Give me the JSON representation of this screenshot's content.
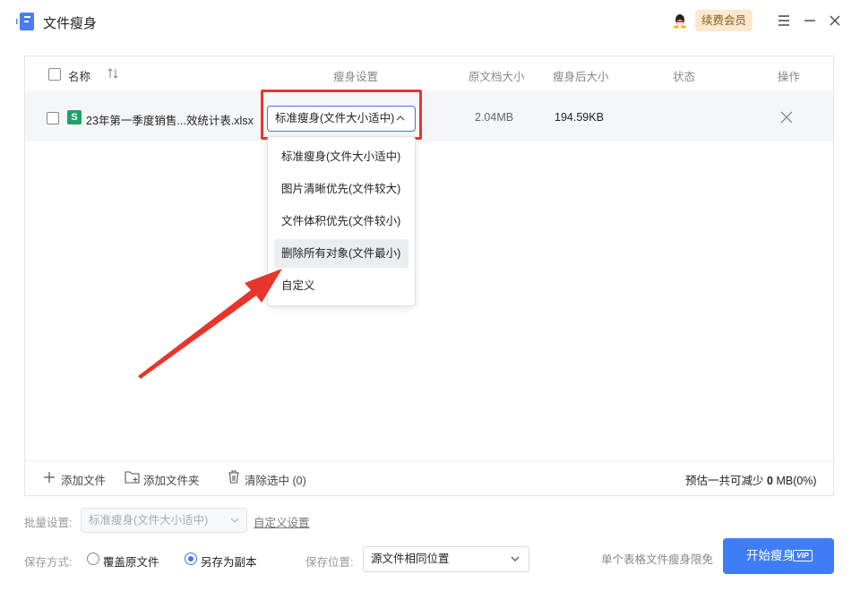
{
  "app": {
    "title": "文件瘦身",
    "vip_label": "续费会员"
  },
  "table": {
    "headers": {
      "name": "名称",
      "slim_setting": "瘦身设置",
      "orig_size": "原文档大小",
      "new_size": "瘦身后大小",
      "status": "状态",
      "action": "操作"
    },
    "rows": [
      {
        "file_name": "23年第一季度销售...效统计表.xlsx",
        "file_badge": "S",
        "slim_setting": "标准瘦身(文件大小适中)",
        "orig_size": "2.04MB",
        "new_size": "194.59KB",
        "status": ""
      }
    ]
  },
  "dropdown": {
    "options": [
      "标准瘦身(文件大小适中)",
      "图片清晰优先(文件较大)",
      "文件体积优先(文件较小)",
      "删除所有对象(文件最小)",
      "自定义"
    ],
    "hovered_index": 3
  },
  "footer_toolbar": {
    "add_file": "添加文件",
    "add_folder": "添加文件夹",
    "clear_selected": "清除选中 (0)",
    "estimate_prefix": "预估一共可减少",
    "estimate_value": "0",
    "estimate_suffix": "MB(0%)"
  },
  "settings": {
    "batch_label": "批量设置:",
    "batch_value": "标准瘦身(文件大小适中)",
    "custom_link": "自定义设置",
    "save_mode_label": "保存方式:",
    "overwrite_label": "覆盖原文件",
    "save_copy_label": "另存为副本",
    "selected_mode": "save_copy",
    "save_location_label": "保存位置:",
    "save_location_value": "源文件相同位置",
    "limit_text": "单个表格文件瘦身限免",
    "start_button": "开始瘦身",
    "start_vip_tag": "VIP"
  },
  "colors": {
    "accent": "#3f7df6",
    "highlight": "#e8352c",
    "vip_bg": "#fce8cf",
    "excel_green": "#21a366"
  }
}
